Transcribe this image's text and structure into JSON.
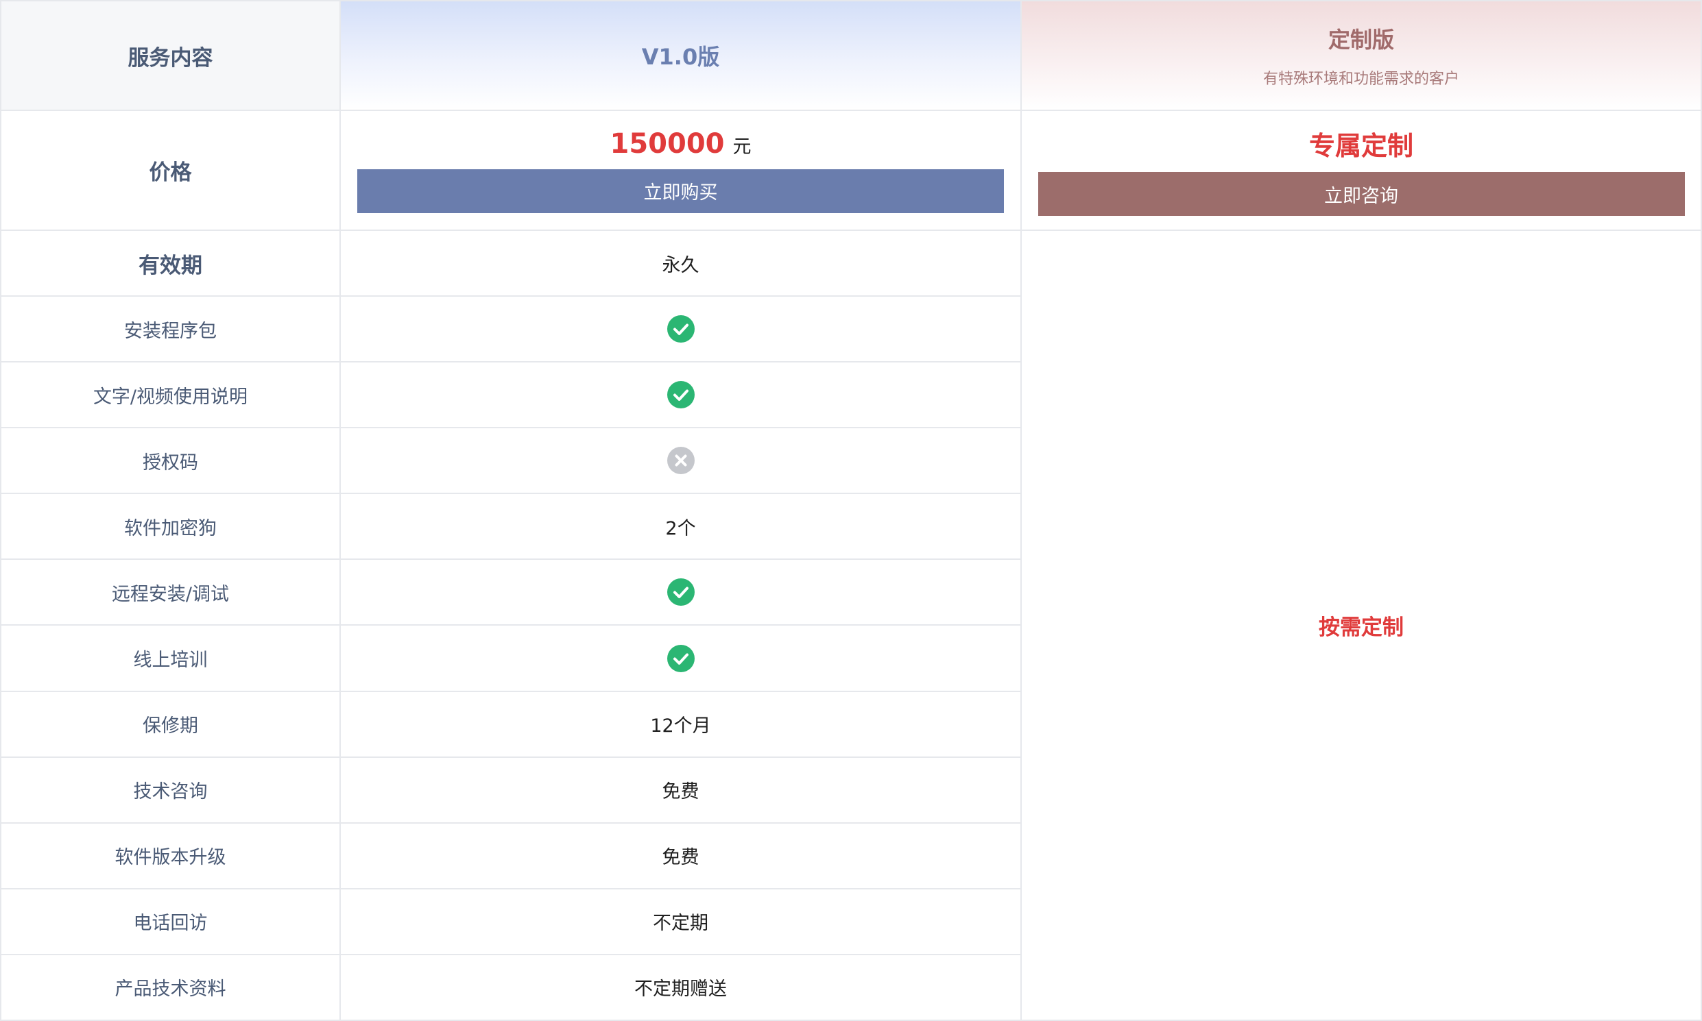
{
  "header": {
    "service_label": "服务内容",
    "v1_label": "V1.0版",
    "custom_title": "定制版",
    "custom_subtitle": "有特殊环境和功能需求的客户"
  },
  "price": {
    "label": "价格",
    "v1_amount": "150000",
    "v1_unit": "元",
    "buy_button": "立即购买",
    "custom_price": "专属定制",
    "consult_button": "立即咨询"
  },
  "rows": [
    {
      "label": "有效期",
      "value": "永久",
      "icon": null
    },
    {
      "label": "安装程序包",
      "value": "",
      "icon": "check-icon"
    },
    {
      "label": "文字/视频使用说明",
      "value": "",
      "icon": "check-icon"
    },
    {
      "label": "授权码",
      "value": "",
      "icon": "cross-icon"
    },
    {
      "label": "软件加密狗",
      "value": "2个",
      "icon": null
    },
    {
      "label": "远程安装/调试",
      "value": "",
      "icon": "check-icon"
    },
    {
      "label": "线上培训",
      "value": "",
      "icon": "check-icon"
    },
    {
      "label": "保修期",
      "value": "12个月",
      "icon": null
    },
    {
      "label": "技术咨询",
      "value": "免费",
      "icon": null
    },
    {
      "label": "软件版本升级",
      "value": "免费",
      "icon": null
    },
    {
      "label": "电话回访",
      "value": "不定期",
      "icon": null
    },
    {
      "label": "产品技术资料",
      "value": "不定期赠送",
      "icon": null
    }
  ],
  "custom_body": "按需定制",
  "colors": {
    "check": "#2bb673",
    "cross": "#c5c7cc",
    "buy_button": "#6a7dad",
    "consult_button": "#9c6d6b",
    "price_red": "#e03b3b"
  }
}
